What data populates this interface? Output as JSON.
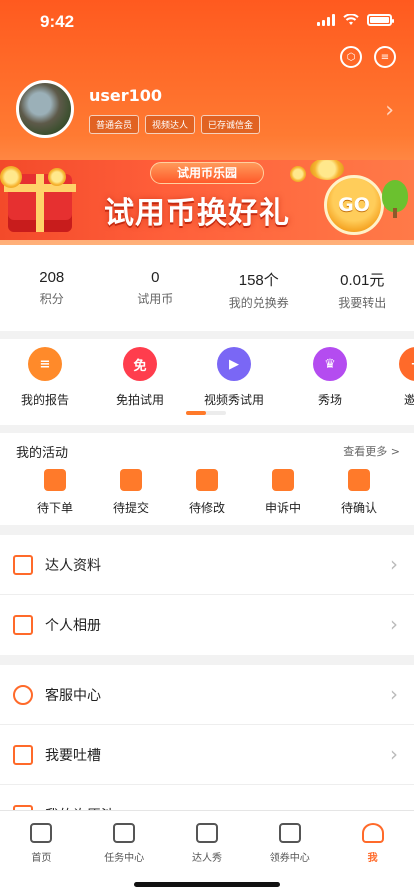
{
  "status_bar": {
    "time": "9:42"
  },
  "profile": {
    "username": "user100",
    "tags": [
      "普通会员",
      "视频达人",
      "已存诚信金"
    ]
  },
  "banner": {
    "pill": "试用币乐园",
    "title": "试用币换好礼",
    "cta": "GO"
  },
  "stats": [
    {
      "value": "208",
      "label": "积分"
    },
    {
      "value": "0",
      "label": "试用币"
    },
    {
      "value": "158个",
      "label": "我的兑换券"
    },
    {
      "value": "0.01元",
      "label": "我要转出"
    }
  ],
  "tools": [
    {
      "label": "我的报告",
      "icon": "report-icon",
      "color": "#ff8a2a"
    },
    {
      "label": "免拍试用",
      "icon": "free-trial-icon",
      "glyph": "免",
      "color": "#ff3d4d"
    },
    {
      "label": "视频秀试用",
      "icon": "video-icon",
      "color": "#7a67f5"
    },
    {
      "label": "秀场",
      "icon": "crown-icon",
      "color": "#b44cf0"
    },
    {
      "label": "邀请",
      "icon": "invite-icon",
      "color": "#ff6a2a"
    }
  ],
  "activity": {
    "title": "我的活动",
    "more": "查看更多 >",
    "items": [
      {
        "label": "待下单",
        "icon": "card-icon"
      },
      {
        "label": "待提交",
        "icon": "clipboard-icon"
      },
      {
        "label": "待修改",
        "icon": "edit-icon"
      },
      {
        "label": "申诉中",
        "icon": "message-icon"
      },
      {
        "label": "待确认",
        "icon": "check-icon"
      }
    ]
  },
  "menu_group_1": [
    {
      "label": "达人资料",
      "icon": "profile-card-icon"
    },
    {
      "label": "个人相册",
      "icon": "image-icon"
    }
  ],
  "menu_group_2": [
    {
      "label": "客服中心",
      "icon": "headset-icon"
    },
    {
      "label": "我要吐槽",
      "icon": "pencil-icon"
    },
    {
      "label": "我的许愿池",
      "icon": "gift-icon"
    }
  ],
  "tabbar": [
    {
      "label": "首页",
      "icon": "home-icon"
    },
    {
      "label": "任务中心",
      "icon": "task-icon"
    },
    {
      "label": "达人秀",
      "icon": "crown-icon"
    },
    {
      "label": "领券中心",
      "icon": "coupon-icon"
    },
    {
      "label": "我",
      "icon": "user-icon",
      "active": true
    }
  ],
  "colors": {
    "brand_orange": "#ff6a2a",
    "header_top": "#ff5a1f"
  }
}
